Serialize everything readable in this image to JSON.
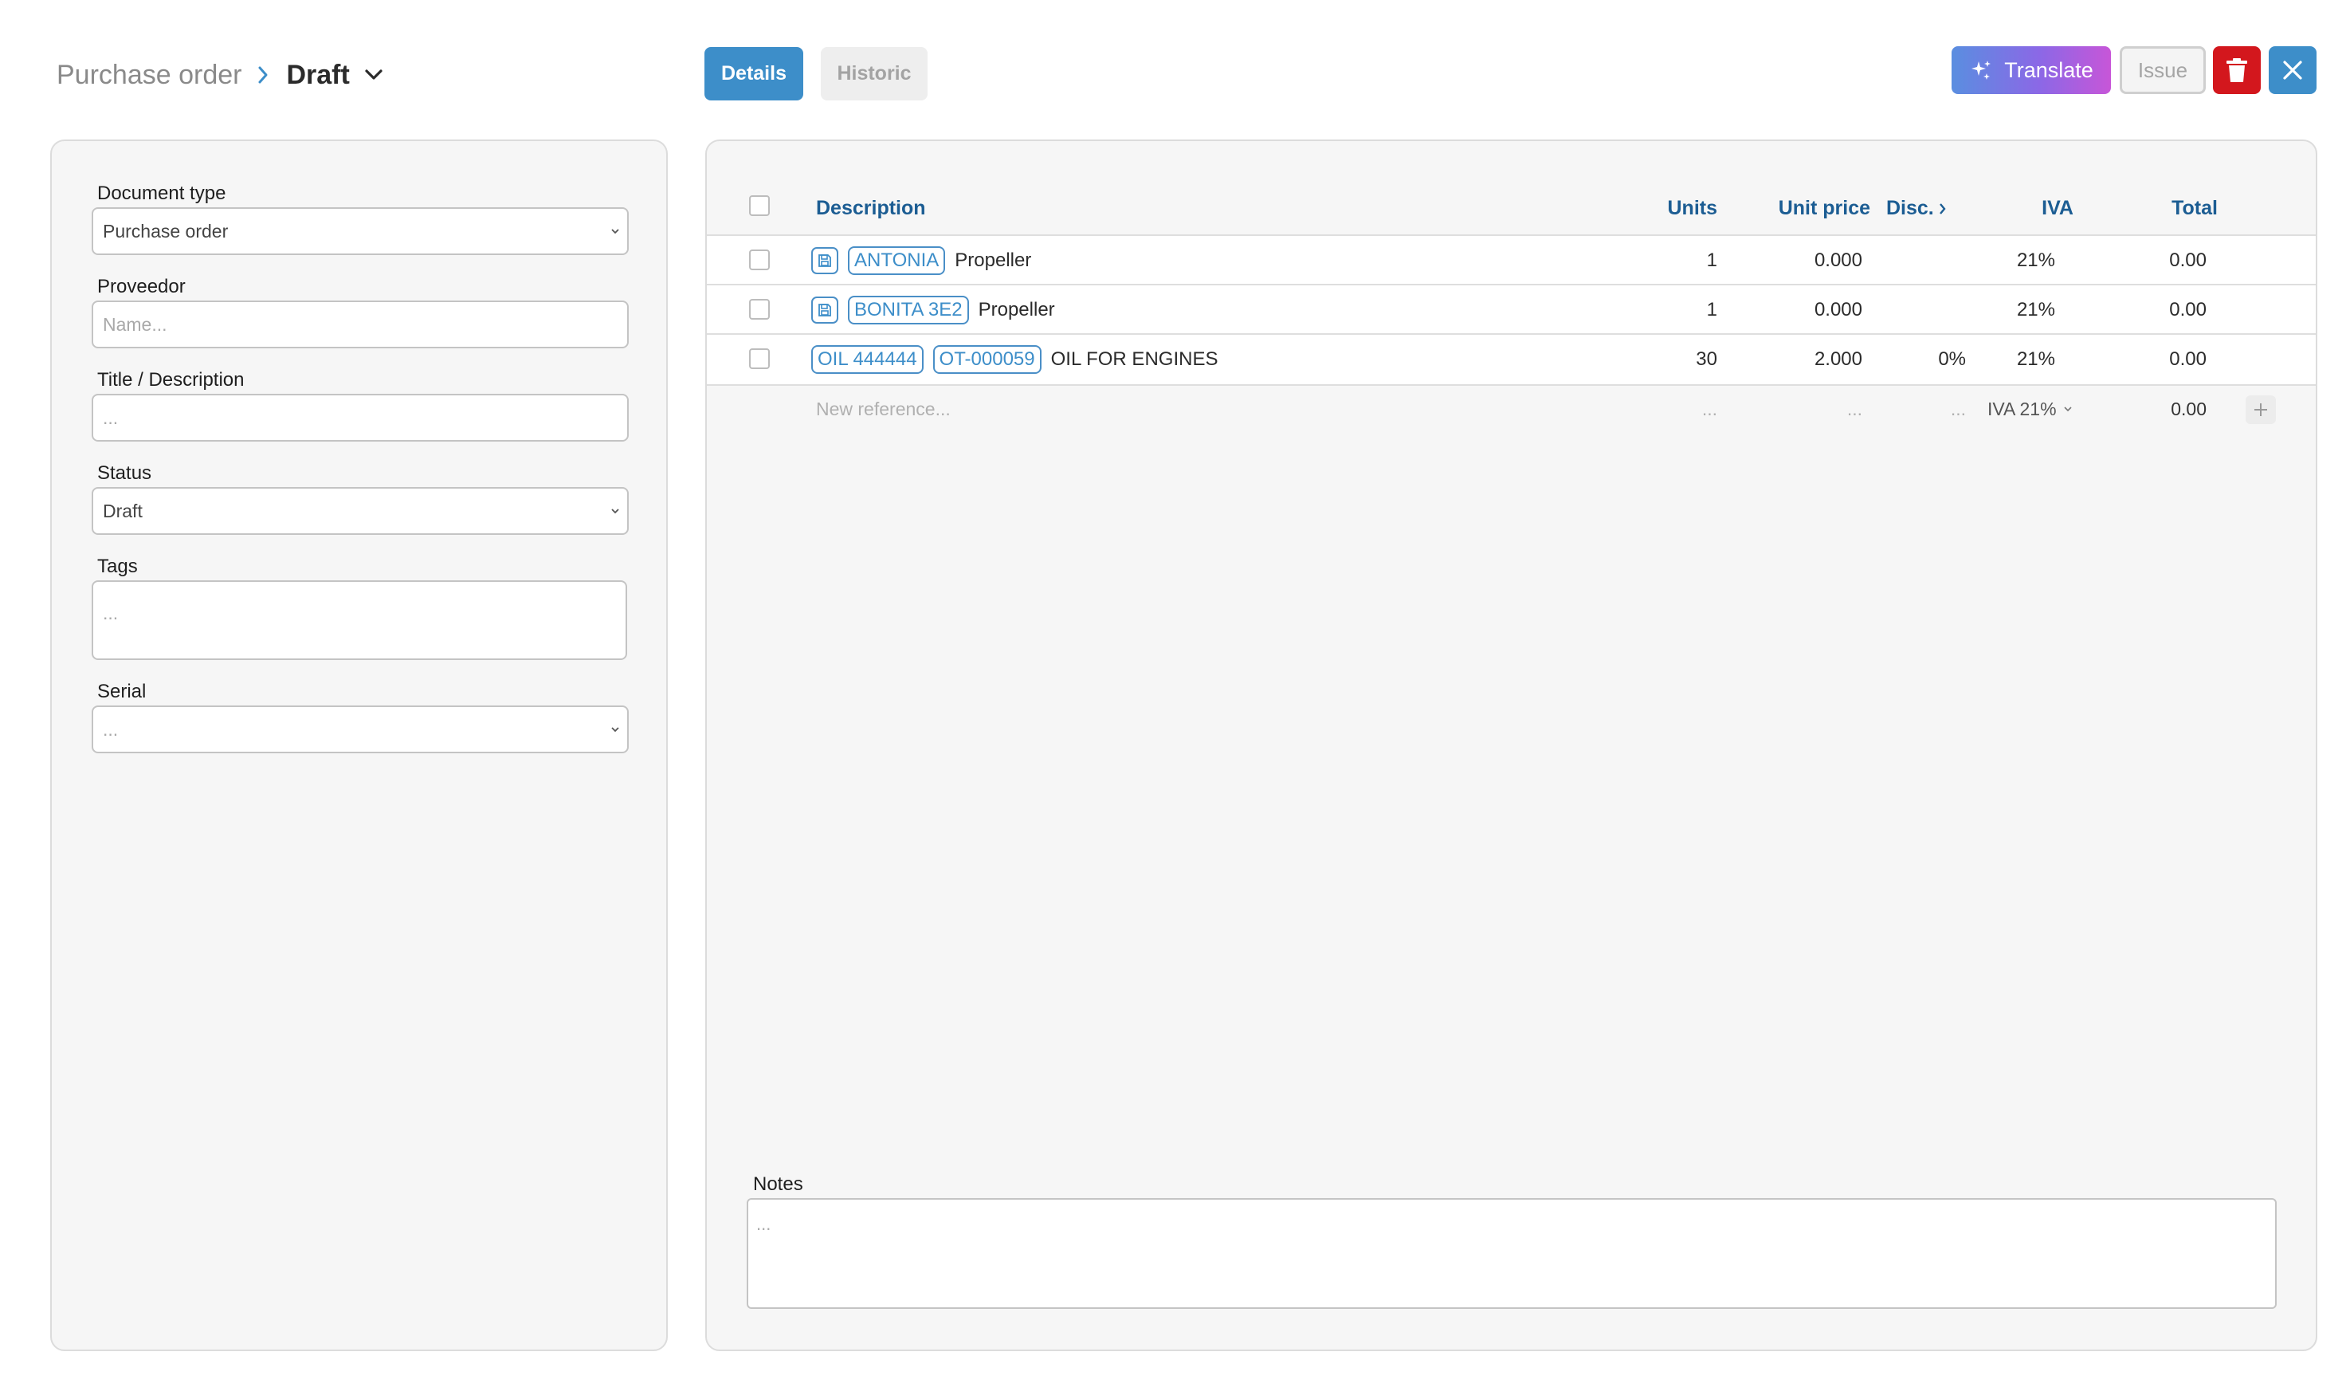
{
  "header": {
    "breadcrumb_root": "Purchase order",
    "breadcrumb_current": "Draft",
    "tabs": [
      {
        "label": "Details",
        "active": true
      },
      {
        "label": "Historic",
        "active": false
      }
    ],
    "actions": {
      "translate_label": "Translate",
      "issue_label": "Issue"
    }
  },
  "form": {
    "document_type": {
      "label": "Document type",
      "value": "Purchase order"
    },
    "proveedor": {
      "label": "Proveedor",
      "placeholder": "Name..."
    },
    "title": {
      "label": "Title / Description",
      "placeholder": "..."
    },
    "status": {
      "label": "Status",
      "value": "Draft"
    },
    "tags": {
      "label": "Tags",
      "placeholder": "..."
    },
    "serial": {
      "label": "Serial",
      "placeholder": "..."
    }
  },
  "lines": {
    "columns": {
      "description": "Description",
      "units": "Units",
      "unit_price": "Unit price",
      "disc": "Disc.",
      "iva": "IVA",
      "total": "Total"
    },
    "rows": [
      {
        "refs": [
          "ANTONIA"
        ],
        "saved": true,
        "description": "Propeller",
        "units": "1",
        "unit_price": "0.000",
        "disc": "",
        "iva": "21%",
        "total": "0.00"
      },
      {
        "refs": [
          "BONITA 3E2"
        ],
        "saved": true,
        "description": "Propeller",
        "units": "1",
        "unit_price": "0.000",
        "disc": "",
        "iva": "21%",
        "total": "0.00"
      },
      {
        "refs": [
          "OIL 444444",
          "OT-000059"
        ],
        "saved": false,
        "description": "OIL FOR ENGINES",
        "units": "30",
        "unit_price": "2.000",
        "disc": "0%",
        "iva": "21%",
        "total": "0.00"
      }
    ],
    "new_row": {
      "placeholder": "New reference...",
      "units": "...",
      "unit_price": "...",
      "disc": "...",
      "iva": "IVA 21%",
      "total": "0.00"
    }
  },
  "notes": {
    "label": "Notes",
    "placeholder": "..."
  },
  "colors": {
    "accent": "#3d8ec9",
    "header_text": "#1c5d93",
    "danger": "#d3171d",
    "translate_gradient": [
      "#5a8ee0",
      "#c756d8"
    ]
  },
  "icons": {
    "breadcrumb_separator": "chevron-right-icon",
    "breadcrumb_dropdown": "chevron-down-icon",
    "translate": "sparkles-icon",
    "delete": "trash-icon",
    "close": "close-icon",
    "saved_ref": "save-icon",
    "add_line": "plus-icon"
  }
}
